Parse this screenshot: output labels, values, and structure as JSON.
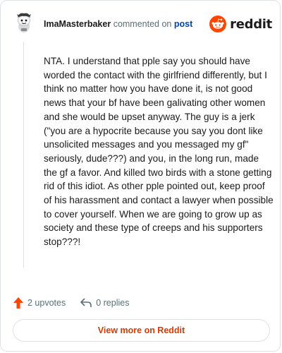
{
  "header": {
    "username": "ImaMasterbaker",
    "action_text": "commented on",
    "post_link": "post",
    "brand": "reddit"
  },
  "comment": {
    "body": "NTA. I understand that pple say you should have worded the contact with the girlfriend differently, but I think no matter how you have done it, is not good news that your bf have been galivating other women and she would be upset anyway. The guy is a jerk (\"you are a hypocrite because you say you dont like unsolicited messages and you messaged my gf\" seriously, dude???) and you, in the long run, made the gf a favor. And killed two birds with a stone getting rid of this idiot. As other pple pointed out, keep proof of his harassment and contact a lawyer when possible to cover yourself. When we are going to grow up as society and these type of creeps and his supporters stop???!"
  },
  "actions": {
    "upvotes_label": "2 upvotes",
    "replies_label": "0 replies",
    "upvote_icon": "upvote-arrow-icon",
    "reply_icon": "reply-arrow-icon"
  },
  "footer": {
    "view_more_label": "View more on Reddit"
  },
  "colors": {
    "brand_orange": "#ff4500",
    "link_blue": "#0045ac",
    "view_more_text": "#d93a00",
    "muted_text": "#576f76",
    "border": "#dfe2e5"
  }
}
